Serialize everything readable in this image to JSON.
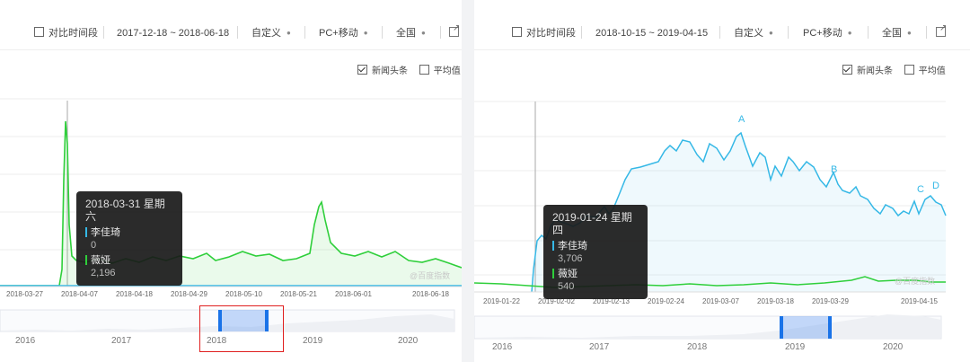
{
  "left": {
    "toolbar": {
      "compare_label": "对比时间段",
      "date_range": "2017-12-18 ~ 2018-06-18",
      "custom_label": "自定义",
      "platform_label": "PC+移动",
      "region_label": "全国"
    },
    "legend": {
      "news_label": "新闻头条",
      "news_checked": true,
      "avg_label": "平均值",
      "avg_checked": false
    },
    "tooltip": {
      "date": "2018-03-31 星期六",
      "series1_name": "李佳琦",
      "series1_value": "0",
      "series2_name": "薇娅",
      "series2_value": "2,196"
    },
    "watermark": "@百度指数",
    "xticks": [
      "2018-03-27",
      "2018-04-07",
      "2018-04-18",
      "2018-04-29",
      "2018-05-10",
      "2018-05-21",
      "2018-06-01",
      "2018-06-18"
    ],
    "years": [
      "2016",
      "2017",
      "2018",
      "2019",
      "2020"
    ]
  },
  "right": {
    "toolbar": {
      "compare_label": "对比时间段",
      "date_range": "2018-10-15 ~ 2019-04-15",
      "custom_label": "自定义",
      "platform_label": "PC+移动",
      "region_label": "全国"
    },
    "legend": {
      "news_label": "新闻头条",
      "news_checked": true,
      "avg_label": "平均值",
      "avg_checked": false
    },
    "tooltip": {
      "date": "2019-01-24 星期四",
      "series1_name": "李佳琦",
      "series1_value": "3,706",
      "series2_name": "薇娅",
      "series2_value": "540"
    },
    "annotations": [
      "A",
      "B",
      "C",
      "D"
    ],
    "watermark": "@百度指数",
    "xticks": [
      "2019-01-22",
      "2019-02-02",
      "2019-02-13",
      "2019-02-24",
      "2019-03-07",
      "2019-03-18",
      "2019-03-29",
      "2019-04-15"
    ],
    "years": [
      "2016",
      "2017",
      "2018",
      "2019",
      "2020"
    ]
  },
  "colors": {
    "series_li": "#35b8e6",
    "series_wei": "#2fcf3b",
    "highlight_box": "#e02020",
    "brush_handle": "#1a73e8"
  }
}
